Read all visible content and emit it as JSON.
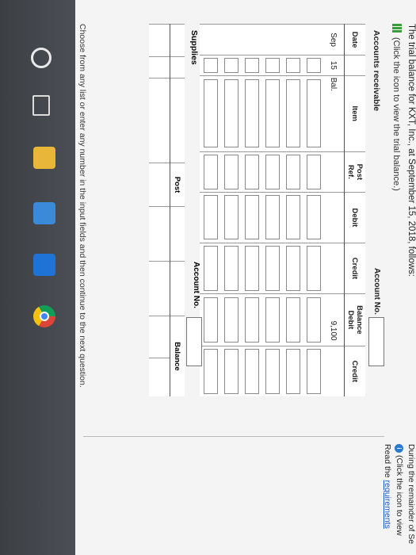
{
  "header": {
    "intro": "The trial balance for KXT, Inc., at September 15, 2018, follows:",
    "trial_link": "(Click the icon to view the trial balance.)"
  },
  "side_panel": {
    "line1": "During the remainder of Se",
    "line2": "(Click the icon to view",
    "read_prefix": "Read the ",
    "requirements_link": "requirements"
  },
  "accounts_receivable": {
    "title": "Accounts receivable",
    "account_no_label": "Account No.",
    "headers": {
      "date": "Date",
      "item": "Item",
      "post": "Post",
      "ref": "Ref.",
      "debit": "Debit",
      "credit": "Credit",
      "balance": "Balance",
      "balance_debit": "Debit",
      "balance_credit": "Credit"
    },
    "first_row": {
      "month": "Sep",
      "day": "15",
      "item": "Bal.",
      "balance_debit": "9,100"
    }
  },
  "supplies": {
    "title": "Supplies",
    "account_no_label": "Account No.",
    "headers": {
      "post": "Post",
      "balance": "Balance"
    }
  },
  "footer": {
    "instruction": "Choose from any list or enter any number in the input fields and then continue to the next question."
  },
  "taskbar": {
    "icons": [
      "cortana-icon",
      "task-view-icon",
      "file-explorer-icon",
      "store-icon",
      "mail-icon",
      "chrome-icon"
    ]
  }
}
